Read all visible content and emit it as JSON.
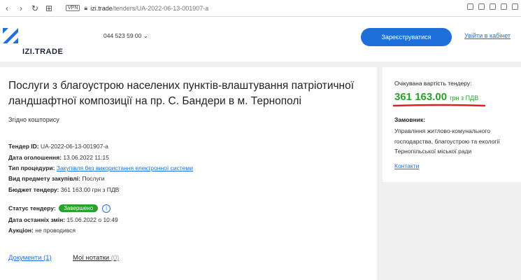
{
  "browser": {
    "vpn": "VPN",
    "url_host": "izi.trade",
    "url_path": "/tenders/UA-2022-06-13-001907-a"
  },
  "header": {
    "logo": "IZI.TRADE",
    "phone": "044 523 59 00 ⌄",
    "register_label": "Зареєструватися",
    "login_label": "Увійти в кабінет"
  },
  "tender": {
    "title": "Послуги з благоустрою населених пунктів-влаштування патріотичної ландшафтної композиції на пр. С. Бандери в м. Тернополі",
    "subtitle": "Згідно кошторису",
    "id_label": "Тендер ID:",
    "id_value": "UA-2022-06-13-001907-a",
    "date_label": "Дата оголошення:",
    "date_value": "13.06.2022 11:15",
    "proc_label": "Тип процедури:",
    "proc_value": "Закупівля без використання електронної системи",
    "subject_label": "Вид предмету закупівлі:",
    "subject_value": "Послуги",
    "budget_label": "Бюджет тендеру:",
    "budget_value": "361 163.00 грн з ПДВ",
    "status_label": "Статус тендеру:",
    "status_value": "Завершено",
    "changed_label": "Дата останніх змін:",
    "changed_value": "15.06.2022 о 10:49",
    "auction_label": "Аукціон:",
    "auction_value": "не проводився"
  },
  "tabs": {
    "documents": "Документи (1)",
    "notes": "Мої нотатки",
    "notes_count": "(0)"
  },
  "side": {
    "expected_label": "Очікувана вартість тендеру:",
    "amount": "361 163.00",
    "currency": "грн з ПДВ",
    "customer_label": "Замовник:",
    "customer_name": "Управління житлово-комунального господарства, благоустрою та екології Тернопільської міської ради",
    "contacts": "Контакти"
  },
  "colors": {
    "accent": "#1e6fd9",
    "success": "#2ca02c",
    "highlight": "#e02020"
  }
}
